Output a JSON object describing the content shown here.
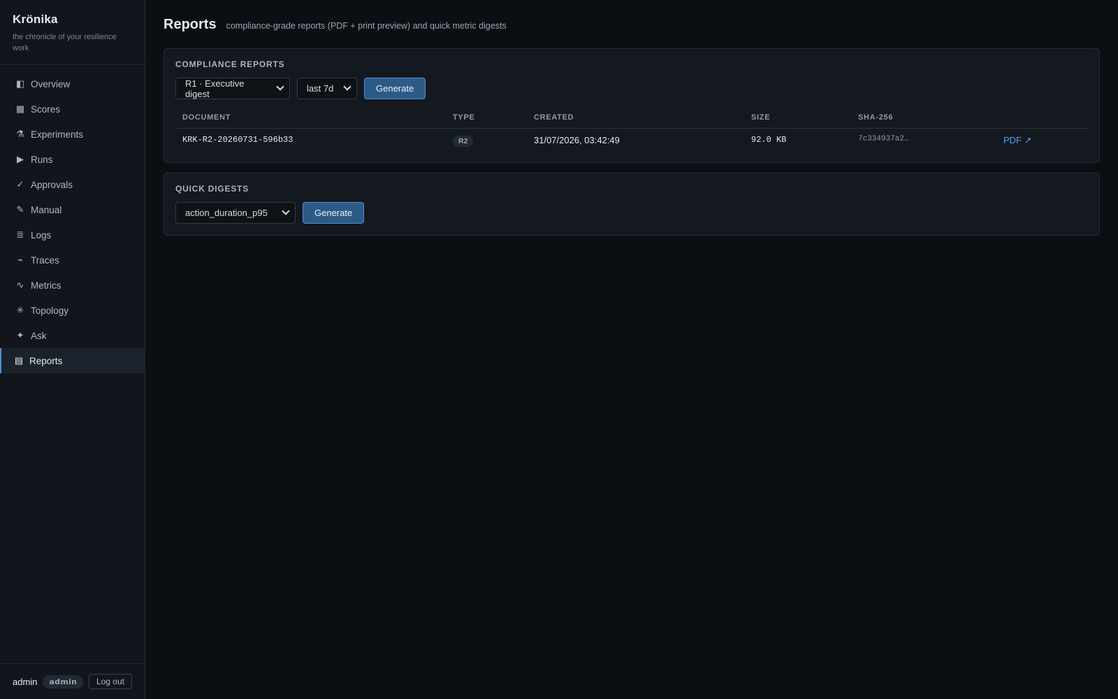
{
  "brand": {
    "name": "Krönika",
    "tagline": "the chronicle of your resilience work"
  },
  "sidebar": {
    "items": [
      {
        "label": "Overview",
        "icon": "◧",
        "icon_name": "overview-icon"
      },
      {
        "label": "Scores",
        "icon": "▦",
        "icon_name": "scores-icon"
      },
      {
        "label": "Experiments",
        "icon": "⚗",
        "icon_name": "flask-icon"
      },
      {
        "label": "Runs",
        "icon": "▶",
        "icon_name": "play-icon"
      },
      {
        "label": "Approvals",
        "icon": "✓",
        "icon_name": "check-icon"
      },
      {
        "label": "Manual",
        "icon": "✎",
        "icon_name": "pencil-icon"
      },
      {
        "label": "Logs",
        "icon": "≣",
        "icon_name": "lines-icon"
      },
      {
        "label": "Traces",
        "icon": "⌁",
        "icon_name": "trace-icon"
      },
      {
        "label": "Metrics",
        "icon": "∿",
        "icon_name": "wave-icon"
      },
      {
        "label": "Topology",
        "icon": "✳",
        "icon_name": "topology-icon"
      },
      {
        "label": "Ask",
        "icon": "✦",
        "icon_name": "sparkle-icon"
      },
      {
        "label": "Reports",
        "icon": "▤",
        "icon_name": "report-icon",
        "active": true
      }
    ]
  },
  "footer": {
    "user": "admin",
    "role": "admin",
    "logout_label": "Log out"
  },
  "page": {
    "title": "Reports",
    "subtitle": "compliance-grade reports (PDF + print preview) and quick metric digests"
  },
  "compliance": {
    "title": "COMPLIANCE REPORTS",
    "report_select": "R1 · Executive digest",
    "window_select": "last 7d",
    "generate_label": "Generate",
    "columns": [
      "DOCUMENT",
      "TYPE",
      "CREATED",
      "SIZE",
      "SHA-256",
      ""
    ],
    "rows": [
      {
        "document": "KRK-R2-20260731-596b33",
        "type": "R2",
        "created": "31/07/2026, 03:42:49",
        "size": "92.0 KB",
        "sha": "7c334937a2…",
        "link": "PDF ↗"
      }
    ]
  },
  "digests": {
    "title": "QUICK DIGESTS",
    "metric_select": "action_duration_p95",
    "generate_label": "Generate"
  },
  "colors": {
    "accent": "#4c8fd6",
    "primary_button": "#2c5a86",
    "link": "#4fa3f0",
    "background": "#0b0f14"
  }
}
